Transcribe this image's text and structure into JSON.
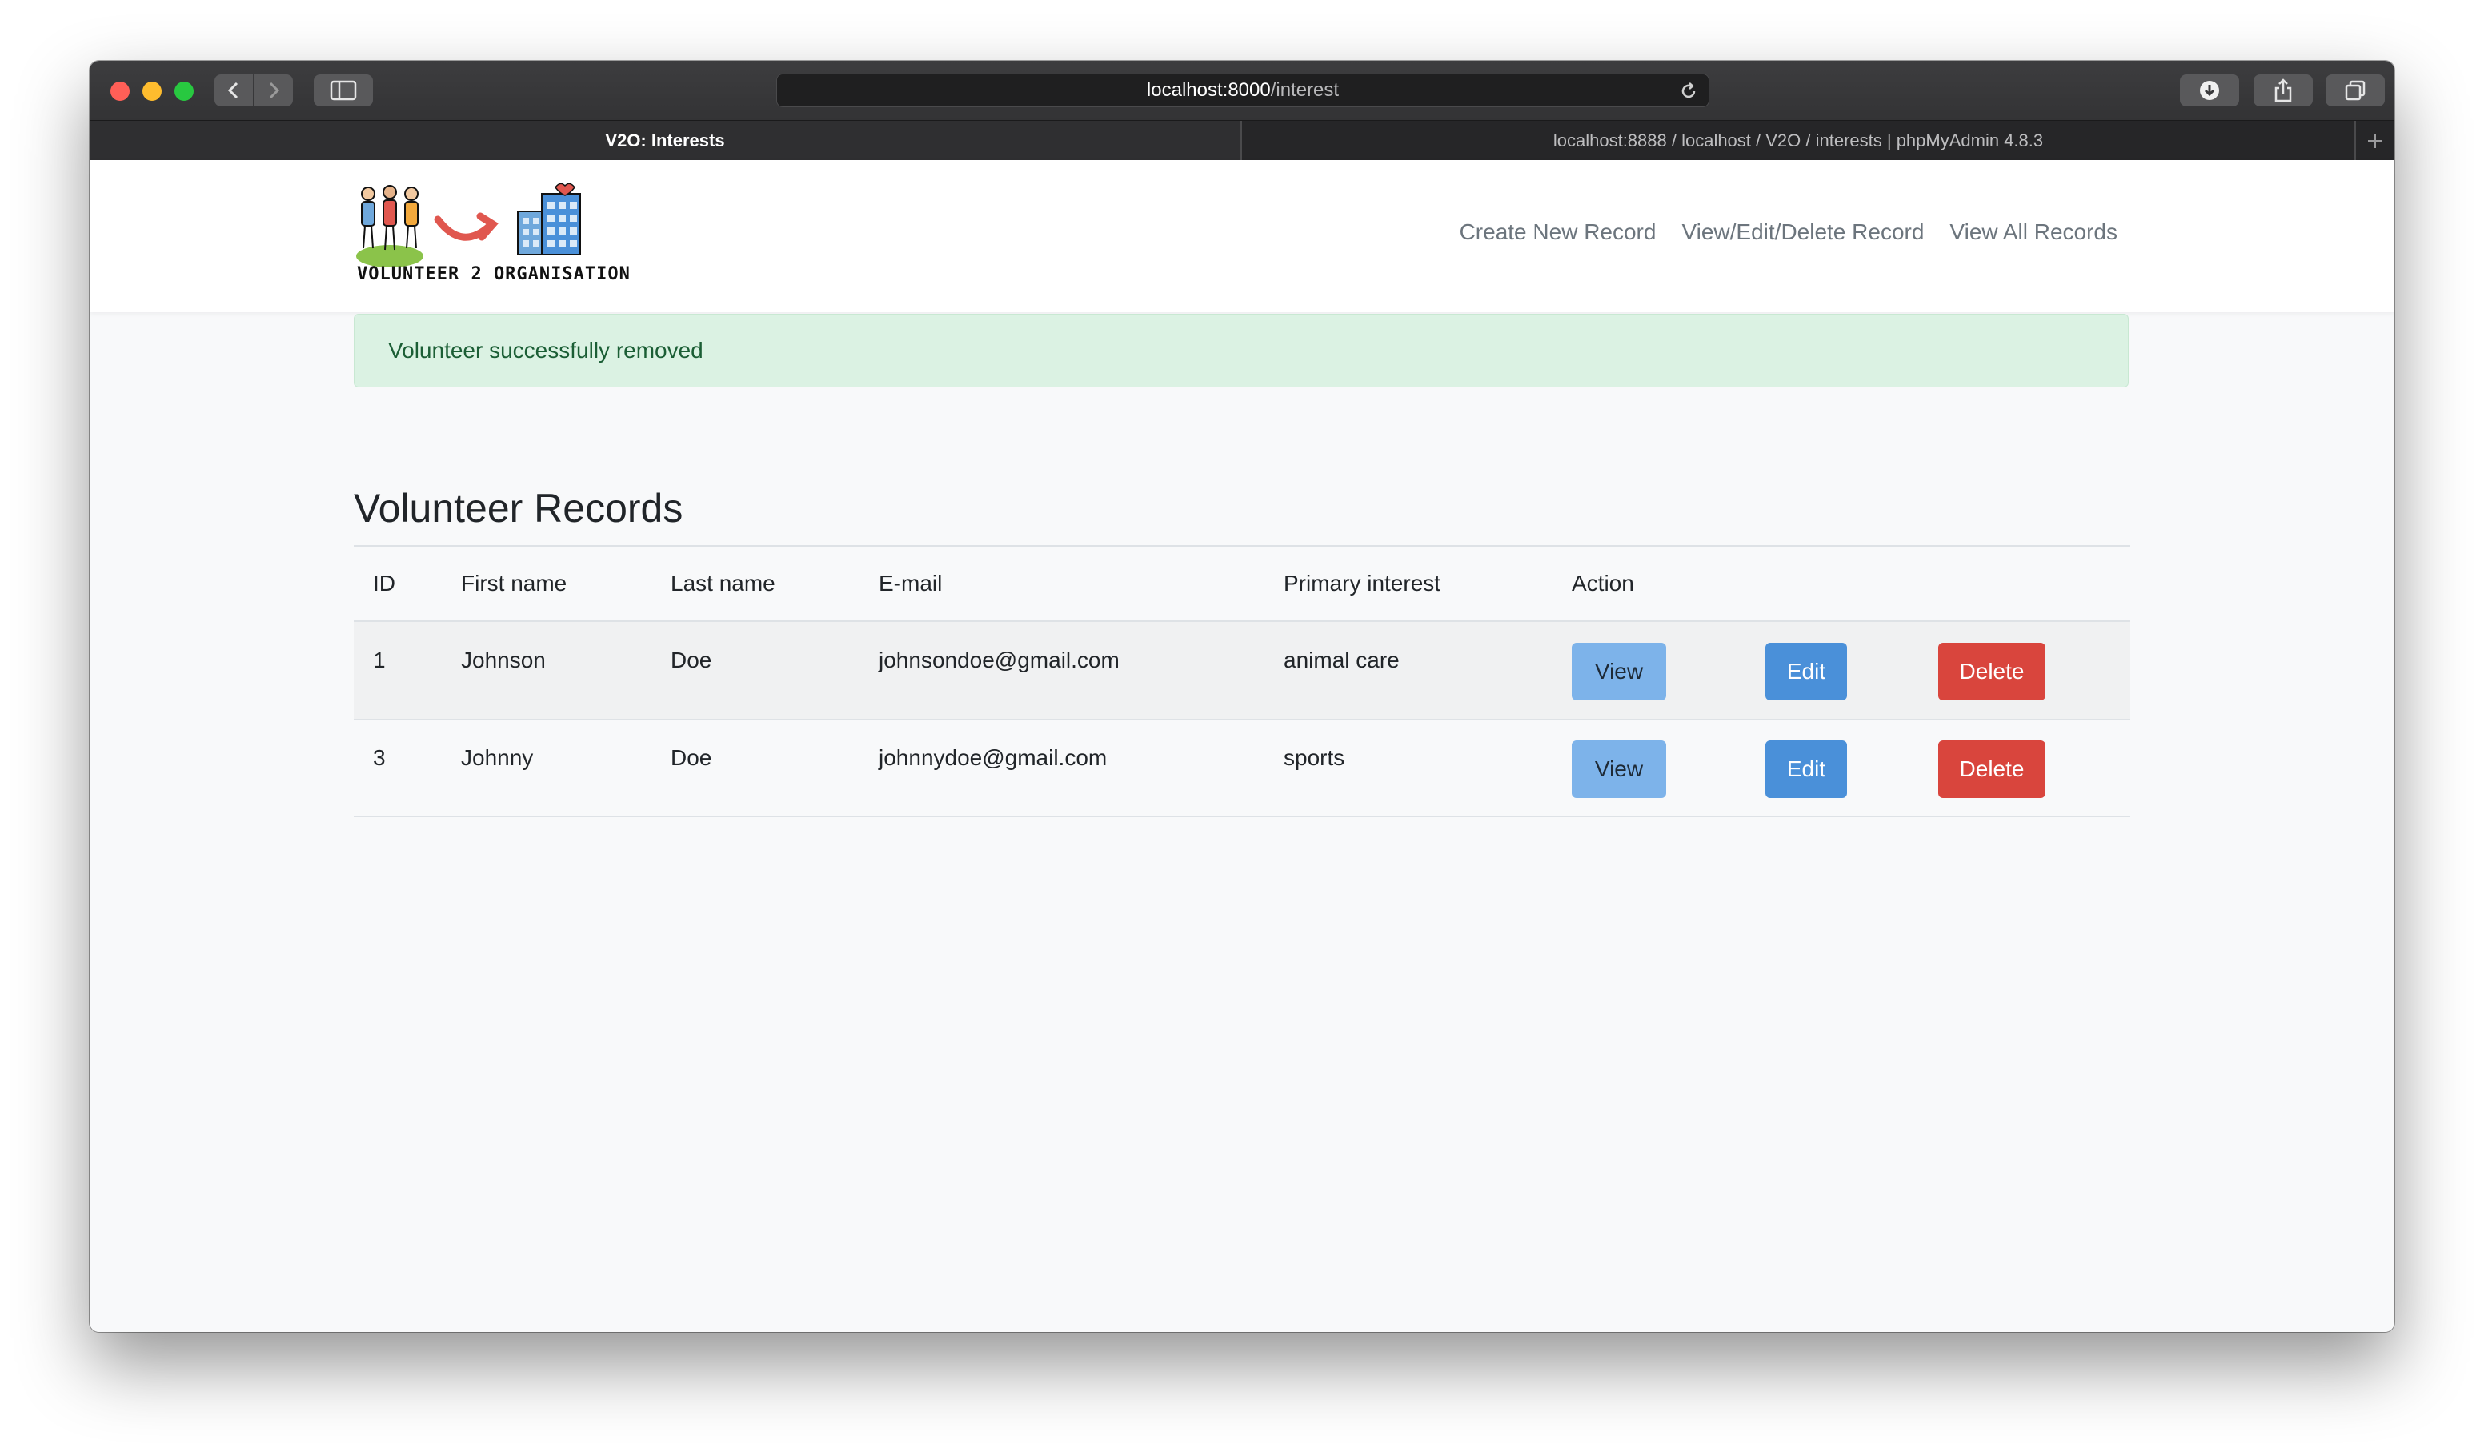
{
  "browser": {
    "address_host": "localhost:8000",
    "address_path": "/interest",
    "tabs": [
      {
        "label": "V2O: Interests"
      },
      {
        "label": "localhost:8888 / localhost / V2O / interests | phpMyAdmin 4.8.3"
      }
    ]
  },
  "navbar": {
    "logo_text": "VOLUNTEER 2 ORGANISATION",
    "links": [
      {
        "label": "Create New Record"
      },
      {
        "label": "View/Edit/Delete Record"
      },
      {
        "label": "View All Records"
      }
    ]
  },
  "alert": {
    "message": "Volunteer successfully removed"
  },
  "main": {
    "title": "Volunteer Records",
    "columns": [
      "ID",
      "First name",
      "Last name",
      "E-mail",
      "Primary interest",
      "Action"
    ],
    "rows": [
      {
        "id": "1",
        "first": "Johnson",
        "last": "Doe",
        "email": "johnsondoe@gmail.com",
        "interest": "animal care"
      },
      {
        "id": "3",
        "first": "Johnny",
        "last": "Doe",
        "email": "johnnydoe@gmail.com",
        "interest": "sports"
      }
    ],
    "actions": {
      "view": "View",
      "edit": "Edit",
      "delete": "Delete"
    }
  },
  "colors": {
    "view_button": "#7db3ea",
    "edit_button": "#4a90d9",
    "delete_button": "#d9453d",
    "alert_background": "#dbf2e3"
  }
}
